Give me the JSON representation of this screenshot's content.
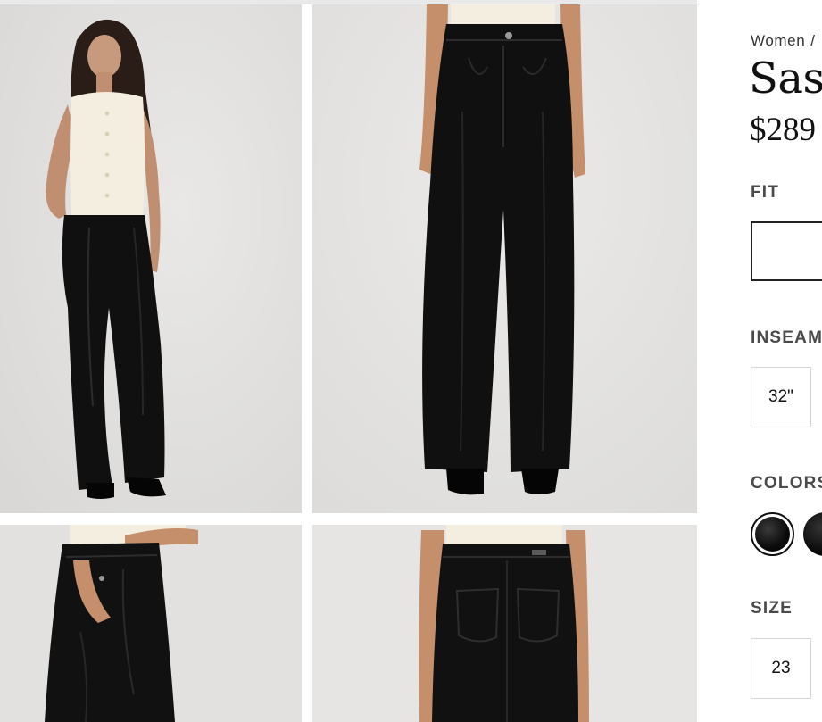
{
  "product": {
    "breadcrumb": [
      "Women",
      "/"
    ],
    "title": "Sasl",
    "price": "$289"
  },
  "options": {
    "fit_label": "FIT",
    "inseam_label": "INSEAM",
    "inseam_value": "32\"",
    "colors_label": "COLORS",
    "size_label": "SIZE",
    "size_value": "23"
  },
  "gallery": {
    "images": [
      "model-full-front",
      "pants-front",
      "pants-side-pocket",
      "pants-back"
    ]
  },
  "colors": {
    "swatch_selected": "#0f0f0f",
    "swatch_other": "#111111",
    "pants": "#101010",
    "top": "#f3eee0"
  }
}
